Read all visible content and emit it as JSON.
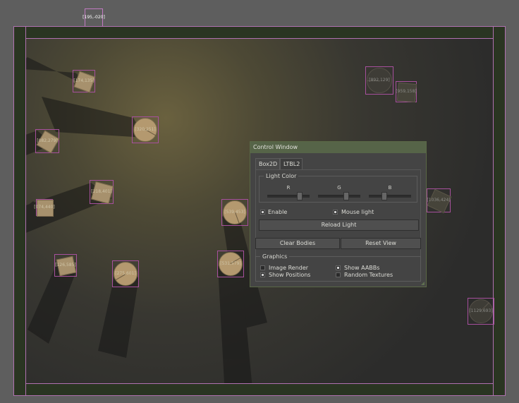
{
  "top_body_label": "[195,-020]",
  "bodies": [
    {
      "label": "[174,135]"
    },
    {
      "label": "[320,251]"
    },
    {
      "label": "[082,279]"
    },
    {
      "label": "[218,401]"
    },
    {
      "label": "[074,440]"
    },
    {
      "label": "[539,453]"
    },
    {
      "label": "[531,579]"
    },
    {
      "label": "[126,585]"
    },
    {
      "label": "[275,601]"
    },
    {
      "label": "[892,129]"
    },
    {
      "label": "[959,158]"
    },
    {
      "label": "[1036,424]"
    },
    {
      "label": "[1129,693]"
    }
  ],
  "control_window": {
    "title": "Control Window",
    "tabs": [
      "Box2D",
      "LTBL2"
    ],
    "light_color": {
      "legend": "Light Color",
      "r_label": "R",
      "g_label": "G",
      "b_label": "B",
      "r_value": 0.8,
      "g_value": 0.7,
      "b_value": 0.35
    },
    "enable": {
      "label": "Enable",
      "checked": true
    },
    "mouse_light": {
      "label": "Mouse light",
      "checked": true
    },
    "reload_label": "Reload Light",
    "clear_label": "Clear Bodies",
    "reset_label": "Reset View",
    "graphics": {
      "legend": "Graphics",
      "image_render": {
        "label": "Image Render",
        "checked": false
      },
      "show_aabbs": {
        "label": "Show AABBs",
        "checked": true
      },
      "show_positions": {
        "label": "Show Positions",
        "checked": true
      },
      "random_textures": {
        "label": "Random Textures",
        "checked": false
      }
    }
  },
  "colors": {
    "aabb": "#a7509d",
    "panel": "#444444",
    "title_bar": "#566448"
  }
}
